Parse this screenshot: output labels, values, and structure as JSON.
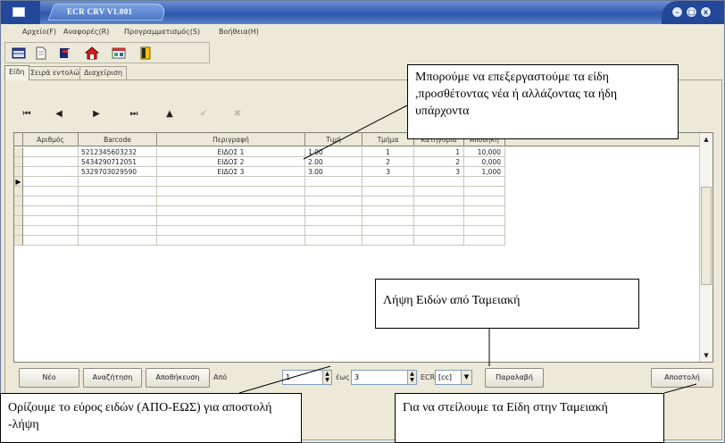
{
  "window": {
    "title": "ECR CRV V1.001"
  },
  "titlebar_buttons": [
    "–",
    "□",
    "x"
  ],
  "menu": [
    "Αρχείο(F)",
    "Αναφορές(R)",
    "Προγραμματισμός(S)",
    "Βοήθεια(H)"
  ],
  "toolbar": {
    "icons": [
      "grid-icon",
      "document-icon",
      "book-icon",
      "home-icon",
      "sheet-icon",
      "exit-door-icon"
    ]
  },
  "tabs": [
    "Είδη",
    "Σειρά εντολών",
    "Διαχείριση"
  ],
  "navigator": {
    "first": "⏮",
    "prev": "◀",
    "next": "▶",
    "last": "⏭",
    "insert": "▲",
    "post": "✔",
    "cancel": "✖"
  },
  "grid": {
    "columns": [
      "Αριθμός",
      "Barcode",
      "Περιγραφή",
      "Τιμή",
      "Τμήμα",
      "Κατηγορία",
      "Αποθήκη"
    ],
    "rows": [
      [
        "",
        "5212345603232",
        "ΕΙΔΟΣ 1",
        "1.00",
        "1",
        "1",
        "10,000"
      ],
      [
        "",
        "5434290712051",
        "ΕΙΔΟΣ 2",
        "2.00",
        "2",
        "2",
        "0,000"
      ],
      [
        "",
        "5329703029590",
        "ΕΙΔΟΣ 3",
        "3.00",
        "3",
        "3",
        "1,000"
      ]
    ],
    "current_row_marker": "▶"
  },
  "bottom": {
    "new_button": "Νέο",
    "search_button": "Αναζήτηση",
    "save_button": "Αποθήκευση",
    "from_label": "Από",
    "from_value": "1",
    "to_label": "έως",
    "to_value": "3",
    "ecr_label": "ECR",
    "ecr_value": "[cc]",
    "receive_button": "Παραλαβή",
    "send_button": "Αποστολή"
  },
  "callouts": {
    "edit": "Μπορούμε να επεξεργαστούμε τα είδη ,προσθέτοντας νέα ή αλλάζοντας τα ήδη υπάρχοντα",
    "receive": "Λήψη Ειδών από Ταμειακή",
    "range": "Ορίζουμε το εύρος ειδών (ΑΠΟ-ΕΩΣ) για αποστολή -λήψη",
    "send": "Για να στείλουμε τα  Είδη στην Ταμειακή"
  }
}
